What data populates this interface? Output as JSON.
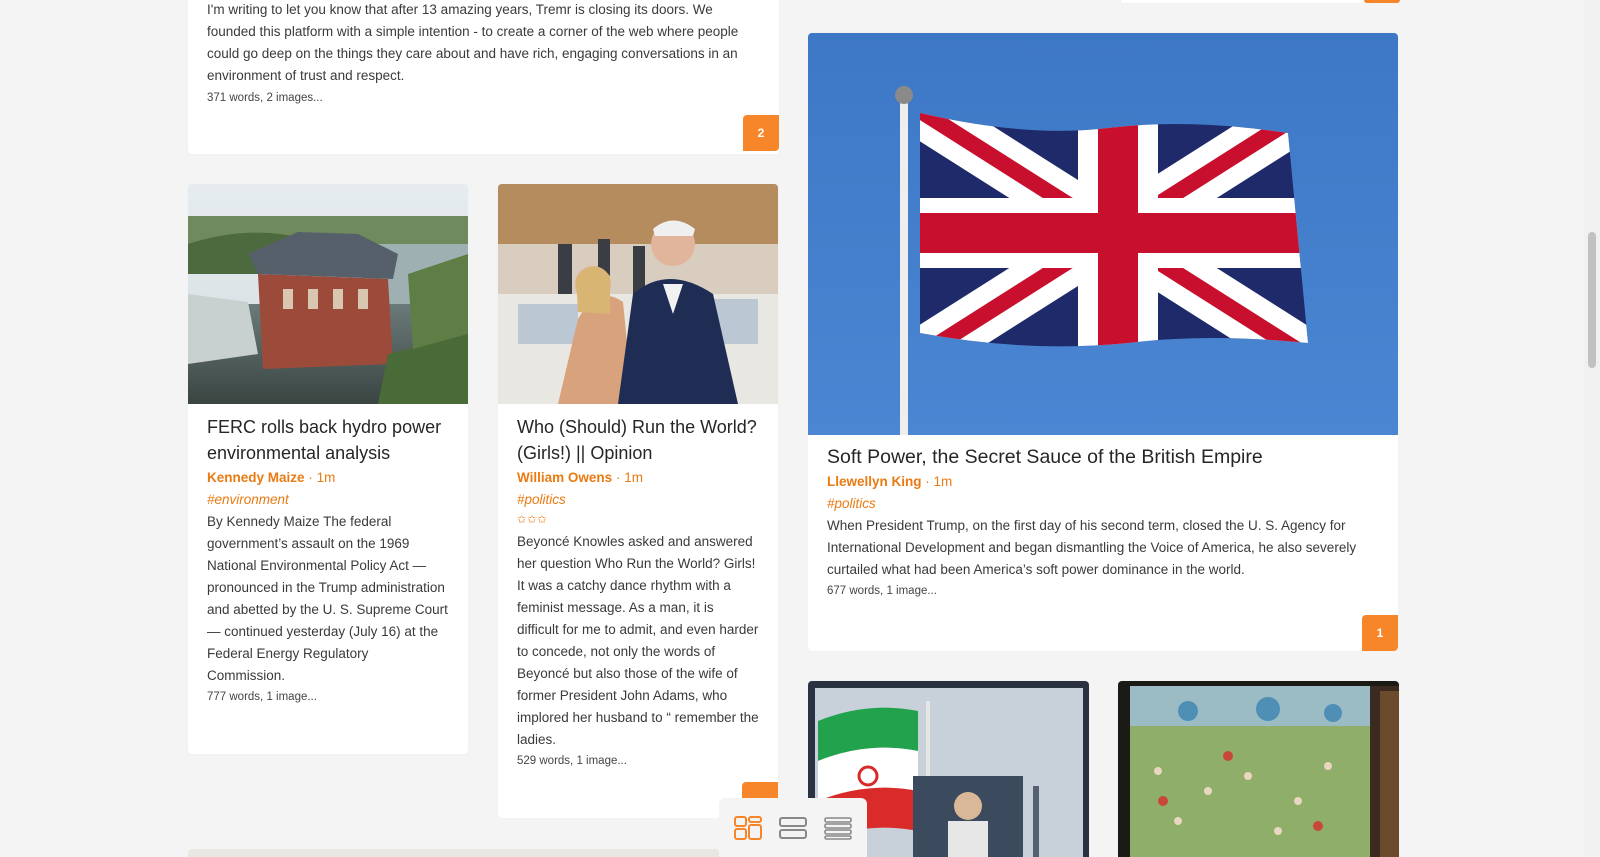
{
  "cards": {
    "tremr": {
      "excerpt": "I'm writing to let you know that after 13 amazing years, Tremr is closing its doors. We founded this platform with a simple intention - to create a corner of the web where people could go deep on the things they care about and have rich, engaging conversations in an environment of trust and respect.",
      "word_count": "371 words, 2 images...",
      "badge": "2"
    },
    "ferc": {
      "title": "FERC rolls back hydro power environmental analysis",
      "author": "Kennedy Maize",
      "separator": "·",
      "age": "1m",
      "tag": "#environment",
      "excerpt": "By Kennedy Maize The federal government’s assault on the 1969 National Environmental Policy Act — pronounced in the Trump administration and abetted by the U. S. Supreme Court — continued yesterday (July 16) at the Federal Energy Regulatory Commission.",
      "word_count": "777 words, 1 image..."
    },
    "who_run": {
      "title": "Who (Should) Run the World? (Girls!) || Opinion",
      "author": "William Owens",
      "separator": "·",
      "age": "1m",
      "tag": "#politics",
      "stars": "✩✩✩",
      "excerpt": "Beyoncé Knowles asked and answered her question Who Run the World? Girls! It was a catchy dance rhythm with a feminist message. As a man, it is difficult for me to admit, and even harder to concede, not only the words of Beyoncé but also those of the wife of former President John Adams, who implored her husband to “ remember the ladies.",
      "word_count": "529 words, 1 image..."
    },
    "soft_power": {
      "title": "Soft Power, the Secret Sauce of the British Empire",
      "author": "Llewellyn King",
      "separator": "·",
      "age": "1m",
      "tag": "#politics",
      "excerpt": "When President Trump, on the first day of his second term, closed the  U. S. Agency for International Development and began dismantling the  Voice of America, he also severely curtailed what had been America’s  soft power dominance in the world.",
      "word_count": "677 words, 1 image...",
      "badge": "1"
    }
  },
  "toolbar": {
    "icons": [
      "grid-layout-icon",
      "card-layout-icon",
      "list-layout-icon"
    ]
  },
  "colors": {
    "accent": "#ea7a12",
    "badge": "#f7862a",
    "background": "#f4f4f4"
  }
}
